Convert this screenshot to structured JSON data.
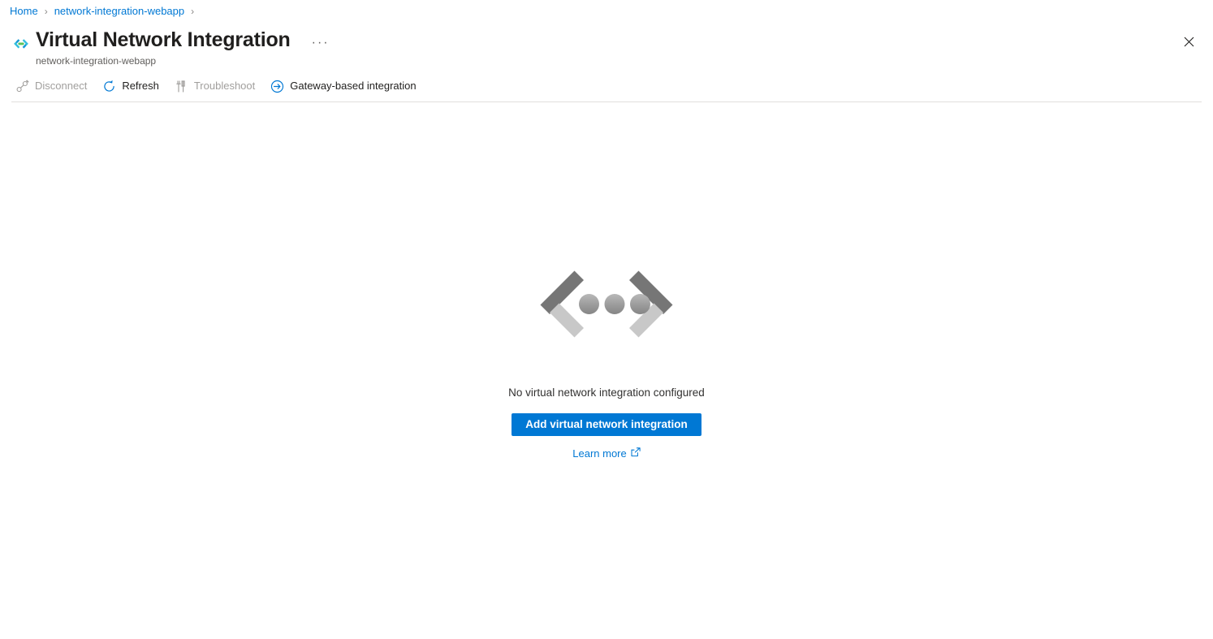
{
  "breadcrumb": {
    "items": [
      {
        "label": "Home"
      },
      {
        "label": "network-integration-webapp"
      }
    ],
    "separator": "›",
    "trailing_separator": "›"
  },
  "header": {
    "icon": "vnet-integration-icon",
    "title": "Virtual Network Integration",
    "subtitle": "network-integration-webapp",
    "more_menu": "···",
    "close_icon": "close-icon"
  },
  "toolbar": {
    "commands": [
      {
        "label": "Disconnect",
        "icon": "disconnect-icon",
        "enabled": false
      },
      {
        "label": "Refresh",
        "icon": "refresh-icon",
        "enabled": true
      },
      {
        "label": "Troubleshoot",
        "icon": "troubleshoot-icon",
        "enabled": false
      },
      {
        "label": "Gateway-based integration",
        "icon": "arrow-circle-right-icon",
        "enabled": true
      }
    ]
  },
  "empty_state": {
    "illustration": "code-brackets-dots-illustration",
    "message": "No virtual network integration configured",
    "primary_button": "Add virtual network integration",
    "learn_more": "Learn more",
    "learn_more_icon": "external-link-icon"
  },
  "colors": {
    "accent": "#0078d4",
    "link": "#0078d4",
    "text": "#323130",
    "text_secondary": "#605e5c",
    "disabled": "#a19f9d",
    "divider": "#e1dfdd",
    "illustration_dark": "#767676",
    "illustration_light": "#c8c8c8"
  }
}
